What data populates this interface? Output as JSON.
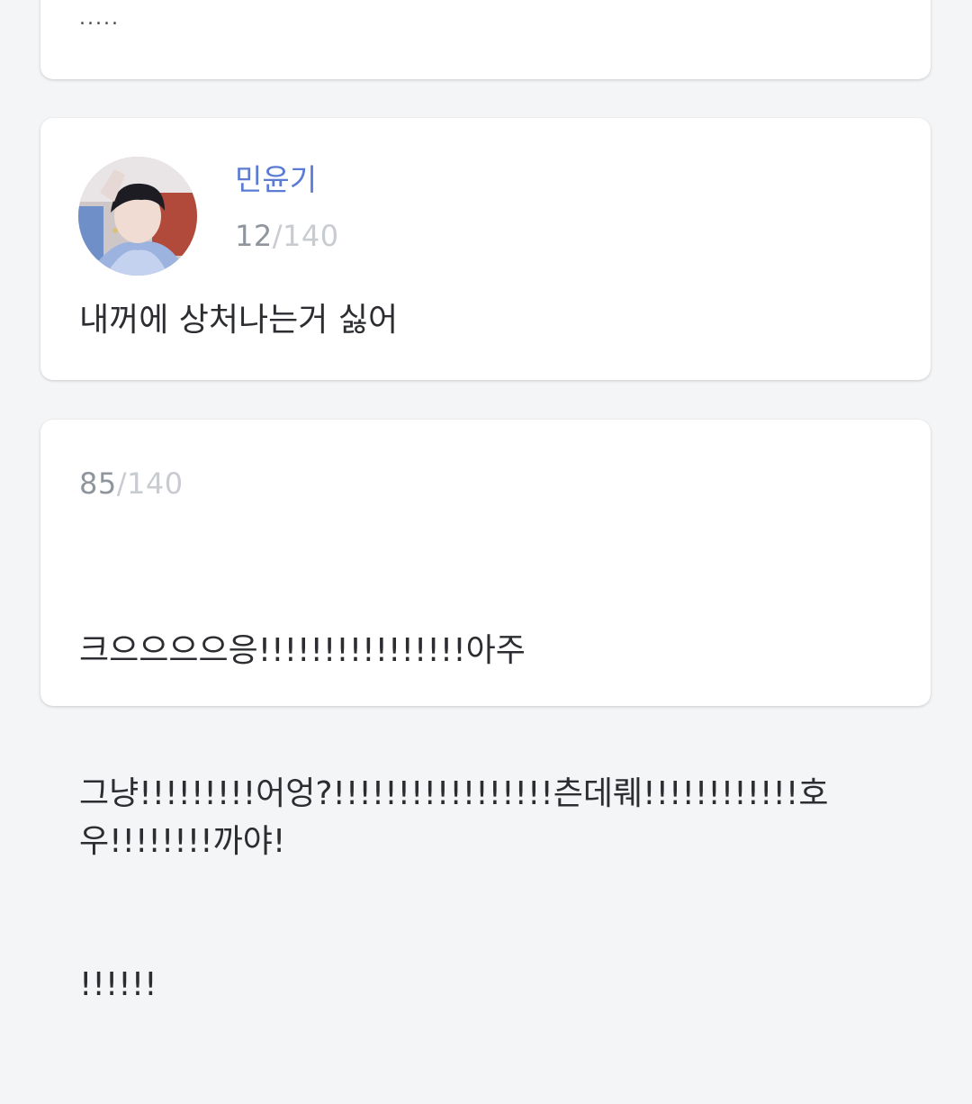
{
  "feed": {
    "posts": [
      {
        "body": "....."
      },
      {
        "author": "민윤기",
        "counter": {
          "used": "12",
          "separator": "/",
          "max": "140"
        },
        "body": "내꺼에 상처나는거 싫어"
      },
      {
        "counter": {
          "used": "85",
          "separator": "/",
          "max": "140"
        },
        "body_lines": [
          "크으으으으응!!!!!!!!!!!!!!!!아주",
          "그냥!!!!!!!!!어엉?!!!!!!!!!!!!!!!!!츤데뤠!!!!!!!!!!!!호우!!!!!!!!까야!",
          "!!!!!!"
        ]
      }
    ]
  },
  "colors": {
    "background": "#f4f5f7",
    "card": "#ffffff",
    "author_name": "#5b7bd5",
    "counter_used": "#8f959c",
    "counter_max": "#c8cbd0",
    "body_text": "#2b2d31"
  }
}
